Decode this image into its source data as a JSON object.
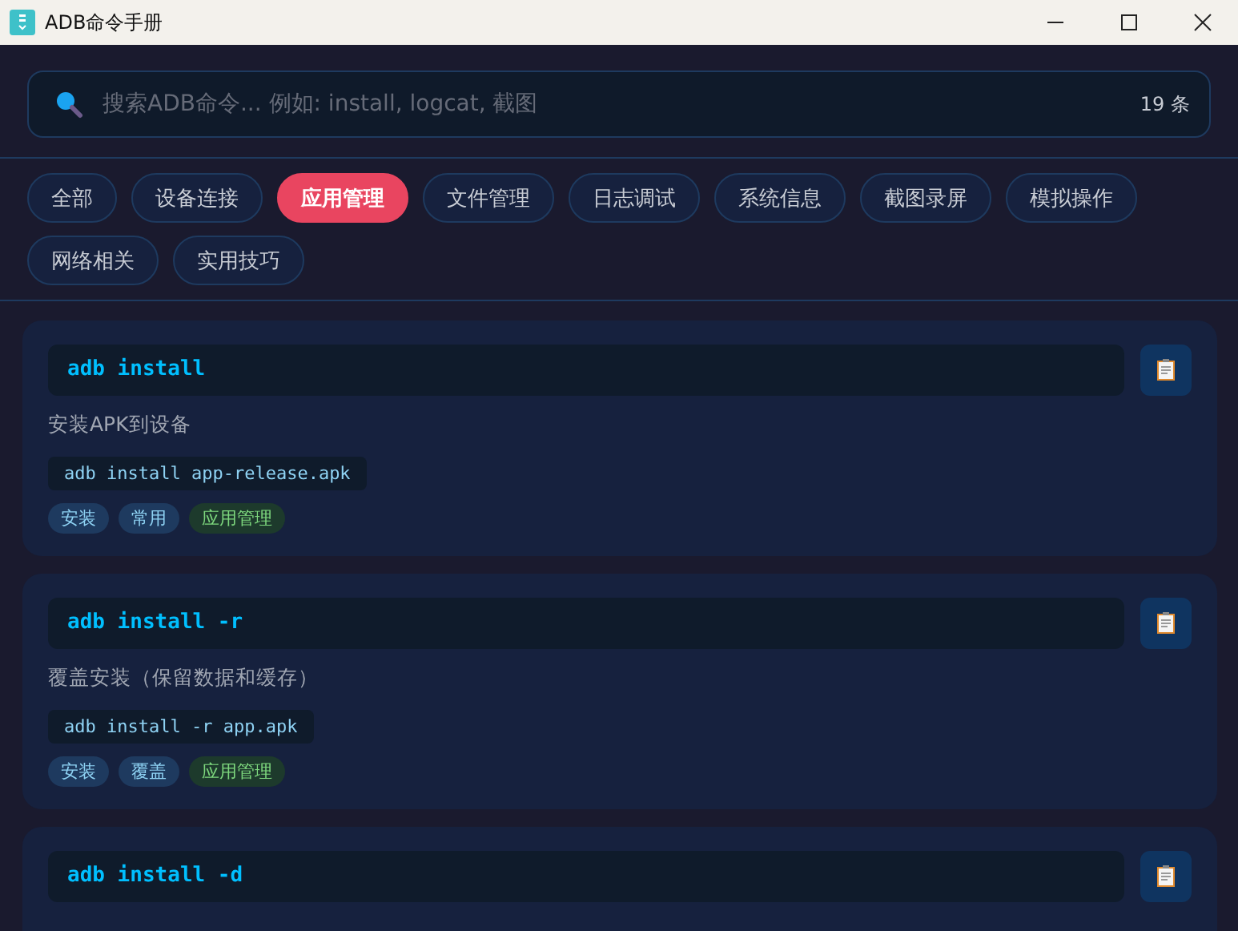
{
  "window": {
    "title": "ADB命令手册"
  },
  "search": {
    "placeholder": "搜索ADB命令... 例如: install, logcat, 截图",
    "count": "19 条"
  },
  "categories": [
    {
      "label": "全部",
      "selected": false
    },
    {
      "label": "设备连接",
      "selected": false
    },
    {
      "label": "应用管理",
      "selected": true
    },
    {
      "label": "文件管理",
      "selected": false
    },
    {
      "label": "日志调试",
      "selected": false
    },
    {
      "label": "系统信息",
      "selected": false
    },
    {
      "label": "截图录屏",
      "selected": false
    },
    {
      "label": "模拟操作",
      "selected": false
    },
    {
      "label": "网络相关",
      "selected": false
    },
    {
      "label": "实用技巧",
      "selected": false
    }
  ],
  "commands": [
    {
      "command": "adb install",
      "description": "安装APK到设备",
      "example": "adb install app-release.apk",
      "tags": [
        {
          "label": "安装",
          "kind": "keyword"
        },
        {
          "label": "常用",
          "kind": "keyword"
        },
        {
          "label": "应用管理",
          "kind": "category"
        }
      ]
    },
    {
      "command": "adb install -r",
      "description": "覆盖安装（保留数据和缓存）",
      "example": "adb install -r app.apk",
      "tags": [
        {
          "label": "安装",
          "kind": "keyword"
        },
        {
          "label": "覆盖",
          "kind": "keyword"
        },
        {
          "label": "应用管理",
          "kind": "category"
        }
      ]
    },
    {
      "command": "adb install -d"
    }
  ]
}
